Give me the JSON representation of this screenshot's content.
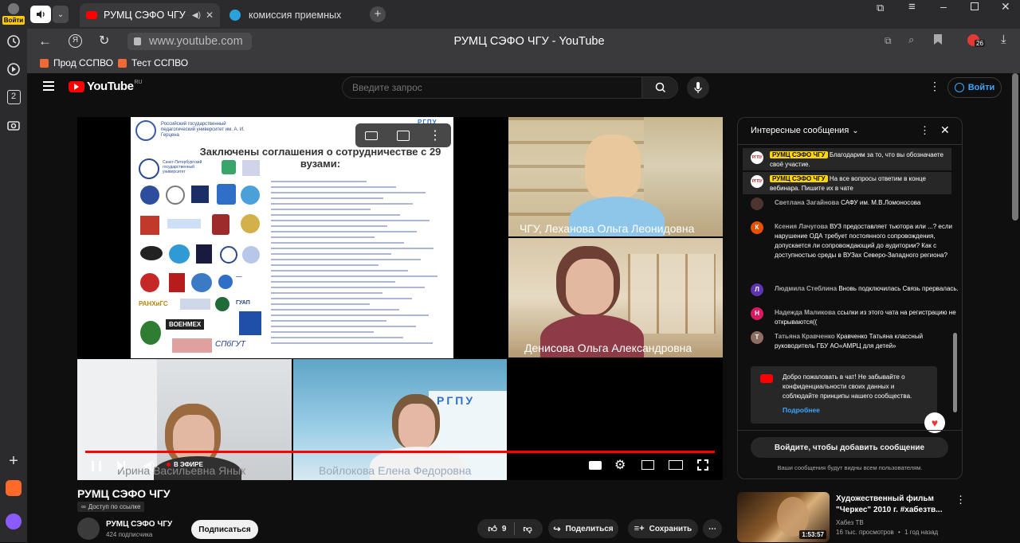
{
  "browser": {
    "profile_label": "Войти",
    "tabs": [
      {
        "label": "РУМЦ СЭФО ЧГУ - Y",
        "active": true
      },
      {
        "label": "комиссия приемных",
        "active": false
      }
    ],
    "address": "www.youtube.com",
    "page_title": "РУМЦ СЭФО ЧГУ - YouTube",
    "ext_badge": "26",
    "sidebar_tab_count": "2",
    "bookmarks": [
      {
        "label": "Прод ССПВО"
      },
      {
        "label": "Тест ССПВО"
      }
    ]
  },
  "youtube": {
    "logo_text": "YouTube",
    "logo_region": "RU",
    "search_placeholder": "Введите запрос",
    "signin_label": "Войти"
  },
  "video": {
    "slide": {
      "org_name": "Российский государственный педагогический университет им. А. И. Герцена",
      "header_badge": "РГПУ",
      "title": "Заключены соглашения о сотрудничестве с 29 вузами:",
      "logo_texts": [
        "Санкт-Петербургский государственный университет",
        "РАНХиГС",
        "ВОЕНМЕХ",
        "ГУАП",
        "СПбГУТ"
      ]
    },
    "participants": [
      {
        "name": "ЧГУ, Леханова Ольга Леонидовна"
      },
      {
        "name": "Денисова Ольга Александровна"
      },
      {
        "name": "Ирина Васильевна Янык"
      },
      {
        "name": "Войлокова Елена Федоровна"
      }
    ],
    "live_label": "В ЭФИРЕ",
    "progress": 1.0
  },
  "info": {
    "title": "РУМЦ СЭФО ЧГУ",
    "access_label": "Доступ по ссылке",
    "channel_name": "РУМЦ СЭФО ЧГУ",
    "subscribers": "424 подписчика",
    "subscribe_label": "Подписаться",
    "likes": "9",
    "share_label": "Поделиться",
    "save_label": "Сохранить"
  },
  "chat": {
    "header": "Интересные сообщения",
    "messages": [
      {
        "author": "РУМЦ СЭФО ЧГУ",
        "owner": true,
        "text": "Благодарим за то, что вы обозначаете своё участие."
      },
      {
        "author": "РУМЦ СЭФО ЧГУ",
        "owner": true,
        "text": "На все вопросы ответим в конце вебинара. Пишите их в чате"
      },
      {
        "author": "Светлана Загайнова",
        "owner": false,
        "initial": "",
        "text": "САФУ им. М.В.Ломоносова"
      },
      {
        "author": "Ксения Лачугова",
        "owner": false,
        "initial": "К",
        "text": "ВУЗ предоставляет тьютора или ...? если нарушение ОДА требует постоянного сопровождения, допускается ли сопровождающий до аудитории? Как с доступностью среды в ВУЗах Северо-Западного региона?"
      },
      {
        "author": "Людмила Стеблина",
        "owner": false,
        "initial": "Л",
        "text": "Вновь подключилась Связь прервалась."
      },
      {
        "author": "Надежда Маликова",
        "owner": false,
        "initial": "Н",
        "text": "ссылки из этого чата на регистрацию не открываются(("
      },
      {
        "author": "Татьяна Кравченко",
        "owner": false,
        "initial": "Т",
        "text": "Кравченко Татьяна классный руководитель ГБУ АО«АМРЦ для детей»"
      }
    ],
    "welcome_text": "Добро пожаловать в чат! Не забывайте о конфиденциальности своих данных и соблюдайте принципы нашего сообщества.",
    "welcome_link": "Подробнее",
    "signin_button": "Войдите, чтобы добавить сообщение",
    "visibility_note": "Ваши сообщения будут видны всем пользователям."
  },
  "recommendation": {
    "title": "Художественный фильм \"Черкес\" 2010 г. #хабезтв...",
    "channel": "Хабез ТВ",
    "views": "16 тыс. просмотров",
    "age": "1 год назад",
    "duration": "1:53:57"
  },
  "colors": {
    "accent_red": "#ff0000",
    "owner_badge": "#ffd600",
    "link_blue": "#3ea6ff"
  }
}
